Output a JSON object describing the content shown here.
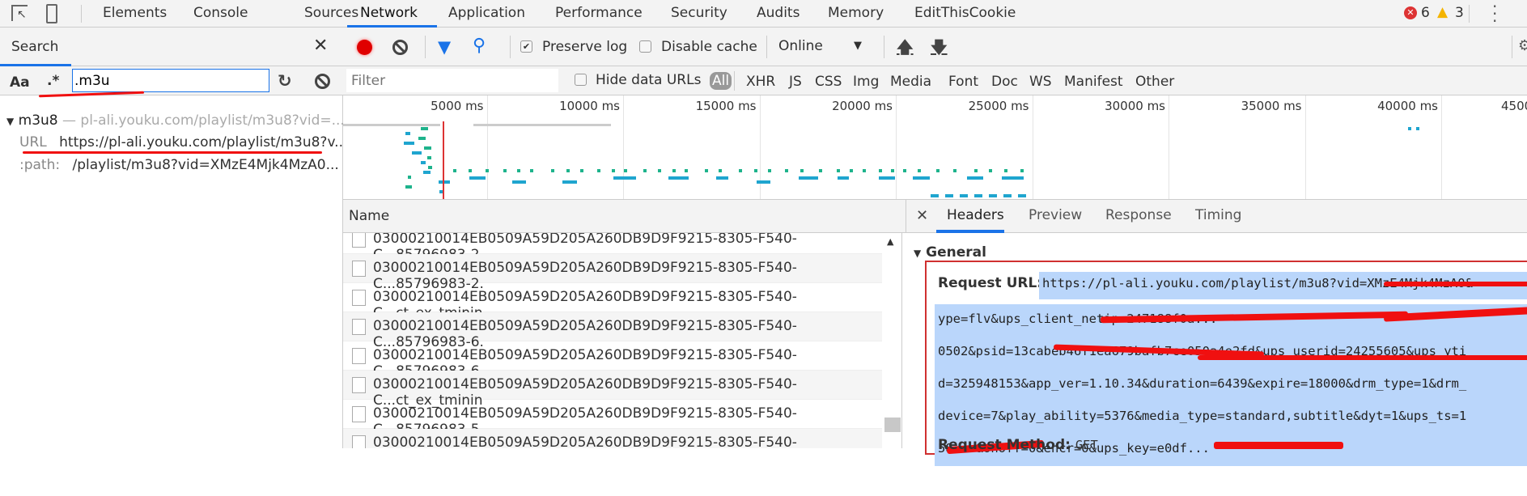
{
  "top_tabs": [
    "Elements",
    "Console",
    "Sources",
    "Network",
    "Application",
    "Performance",
    "Security",
    "Audits",
    "Memory",
    "EditThisCookie"
  ],
  "active_tab": "Network",
  "errors": "6",
  "warnings": "3",
  "search_panel": {
    "title": "Search",
    "case_label": "Aa",
    "regex_label": ".*",
    "query": ".m3u",
    "result": {
      "file": "m3u8",
      "dash": "—",
      "file_url": "pl-ali.youku.com/playlist/m3u8?vid=...",
      "url_label": "URL",
      "url_value": "https://pl-ali.youku.com/playlist/m3u8?v...",
      "path_label": ":path:",
      "path_value": "/playlist/m3u8?vid=XMzE4Mjk4MzA0..."
    }
  },
  "toolbar": {
    "preserve_log": "Preserve log",
    "preserve_log_checked": true,
    "disable_cache": "Disable cache",
    "disable_cache_checked": false,
    "throttle": "Online"
  },
  "filter": {
    "placeholder": "Filter",
    "hide_data_urls": "Hide data URLs",
    "types": [
      "All",
      "XHR",
      "JS",
      "CSS",
      "Img",
      "Media",
      "Font",
      "Doc",
      "WS",
      "Manifest",
      "Other"
    ],
    "active_type": "All"
  },
  "overview": {
    "ticks": [
      "5000 ms",
      "10000 ms",
      "15000 ms",
      "20000 ms",
      "25000 ms",
      "30000 ms",
      "35000 ms",
      "40000 ms",
      "4500"
    ]
  },
  "requests": {
    "header": "Name",
    "rows": [
      "03000210014EB0509A59D205A260DB9D9F9215-8305-F540-C...85796983-2.",
      "03000210014EB0509A59D205A260DB9D9F9215-8305-F540-C...85796983-2.",
      "03000210014EB0509A59D205A260DB9D9F9215-8305-F540-C...ct_ex_tminin",
      "03000210014EB0509A59D205A260DB9D9F9215-8305-F540-C...85796983-6.",
      "03000210014EB0509A59D205A260DB9D9F9215-8305-F540-C...85796983-6.",
      "03000210014EB0509A59D205A260DB9D9F9215-8305-F540-C...ct_ex_tminin",
      "03000210014EB0509A59D205A260DB9D9F9215-8305-F540-C...85796983-5.",
      "03000210014EB0509A59D205A260DB9D9F9215-8305-F540-C...85796983-5.",
      "03000210014EB0509A59D205A260DB9D9F9215-8305-F540-C...ct_ex_tminin"
    ]
  },
  "details": {
    "tabs": [
      "Headers",
      "Preview",
      "Response",
      "Timing"
    ],
    "active": "Headers",
    "section": "General",
    "request_url_label": "Request URL:",
    "request_url_lines": [
      "https://pl-ali.youku.com/playlist/m3u8?vid=XMzE4Mjk4MzA0&",
      "ype=flv&ups_client_netip=247188f0a...",
      "0502&psid=13cabeb46f1ea679bafb7ce050a4e2fd&ups_userid=24255605&ups_yti",
      "d=325948153&app_ver=1.10.34&duration=6439&expire=18000&drm_type=1&drm_",
      "device=7&play_ability=5376&media_type=standard,subtitle&dyt=1&ups_ts=1",
      "58...&onOff=0&encr=0&ups_key=e0df..."
    ],
    "request_method_label": "Request Method:",
    "request_method": "GET"
  },
  "colors": {
    "accent": "#1a73e8",
    "record": "#e00000",
    "selection": "#bad6fb",
    "annotation": "#f01010"
  }
}
